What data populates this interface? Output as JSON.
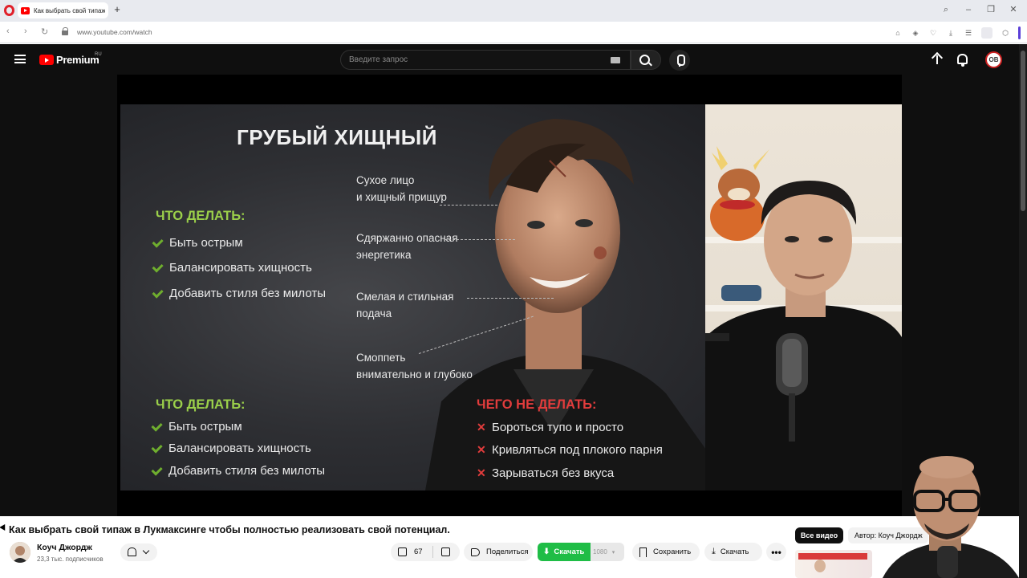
{
  "browser": {
    "tab_title": "Как выбрать свой типаж",
    "url": "www.youtube.com/watch"
  },
  "youtube": {
    "logo_text": "Premium",
    "region": "RU",
    "search_placeholder": "Введите запрос",
    "avatar_initials": "OB"
  },
  "slide": {
    "title": "ГРУБЫЙ ХИЩНЫЙ",
    "do_top": {
      "heading": "ЧТО ДЕЛАТЬ:",
      "items": [
        "Быть острым",
        "Балансировать хищность",
        "Добавить стиля без милоты"
      ]
    },
    "annotations": [
      "Сухое лицо\nи хищный прищур",
      "Сдяржанно опасная\nэнергетика",
      "Смелая и стильная\nподача",
      "Смоппеть\nвнимательно и глубоко"
    ],
    "do_bottom": {
      "heading": "ЧТО ДЕЛАТЬ:",
      "items": [
        "Быть острым",
        "Балансировать хищность",
        "Добавить стиля без милоты"
      ]
    },
    "dont": {
      "heading": "ЧЕГО НЕ ДЕЛАТЬ:",
      "items": [
        "Бороться тупо и просто",
        "Кривляться под плокого парня",
        "Зарываться без вкуса"
      ]
    }
  },
  "video": {
    "title": "Как выбрать свой типаж в Лукмаксинге чтобы полностью реализовать свой потенциал.",
    "channel_name": "Коуч Джордж",
    "subscribers": "23,3 тыс. подписчиков",
    "likes": "67",
    "share_label": "Поделиться",
    "download_ext_label": "Скачать",
    "download_quality": "1080",
    "save_label": "Сохранить",
    "download_label": "Скачать",
    "more": "•••"
  },
  "sidebar": {
    "chip_all": "Все видео",
    "chip_author": "Автор: Коуч Джордж"
  },
  "colors": {
    "accent_green": "#9bd04a",
    "check_green": "#6fae2e",
    "negative_red": "#e23c3c",
    "download_green": "#1fbd46",
    "yt_red": "#ff0000"
  }
}
